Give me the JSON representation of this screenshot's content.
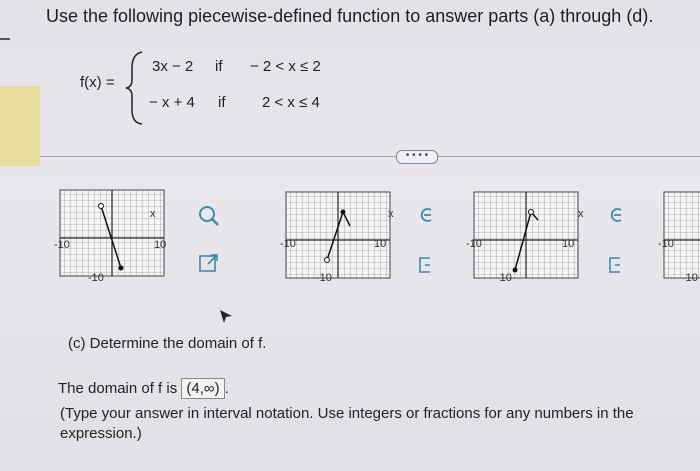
{
  "question": {
    "instruction": "Use the following piecewise-defined function to answer parts (a) through (d).",
    "function_name": "f(x) =",
    "pieces": [
      {
        "expr": "3x − 2",
        "if": "if",
        "cond": "− 2 < x ≤ 2"
      },
      {
        "expr": "− x + 4",
        "if": "if",
        "cond": "2 < x ≤ 4"
      }
    ]
  },
  "more_button": "• • • •",
  "graph_options": [
    {
      "xlabel": "x",
      "left_tick": "-10",
      "right_tick": "10",
      "bottom_tick": "-10"
    },
    {
      "xlabel": "x",
      "left_tick": "-10",
      "right_tick": "10",
      "bottom_tick": "-10"
    },
    {
      "xlabel": "x",
      "left_tick": "-10",
      "right_tick": "10",
      "bottom_tick": "-10"
    },
    {
      "left_tick": "-10",
      "bottom_tick": "-10"
    }
  ],
  "part_c": {
    "prompt": "(c) Determine the domain of f.",
    "answer_prefix": "The domain of f is",
    "answer_value": "(4,∞)",
    "answer_suffix": ".",
    "note": "(Type your answer in interval notation. Use integers or fractions for any numbers in the expression.)"
  },
  "colors": {
    "highlight": "#e7dd9c",
    "grid": "#555555"
  }
}
